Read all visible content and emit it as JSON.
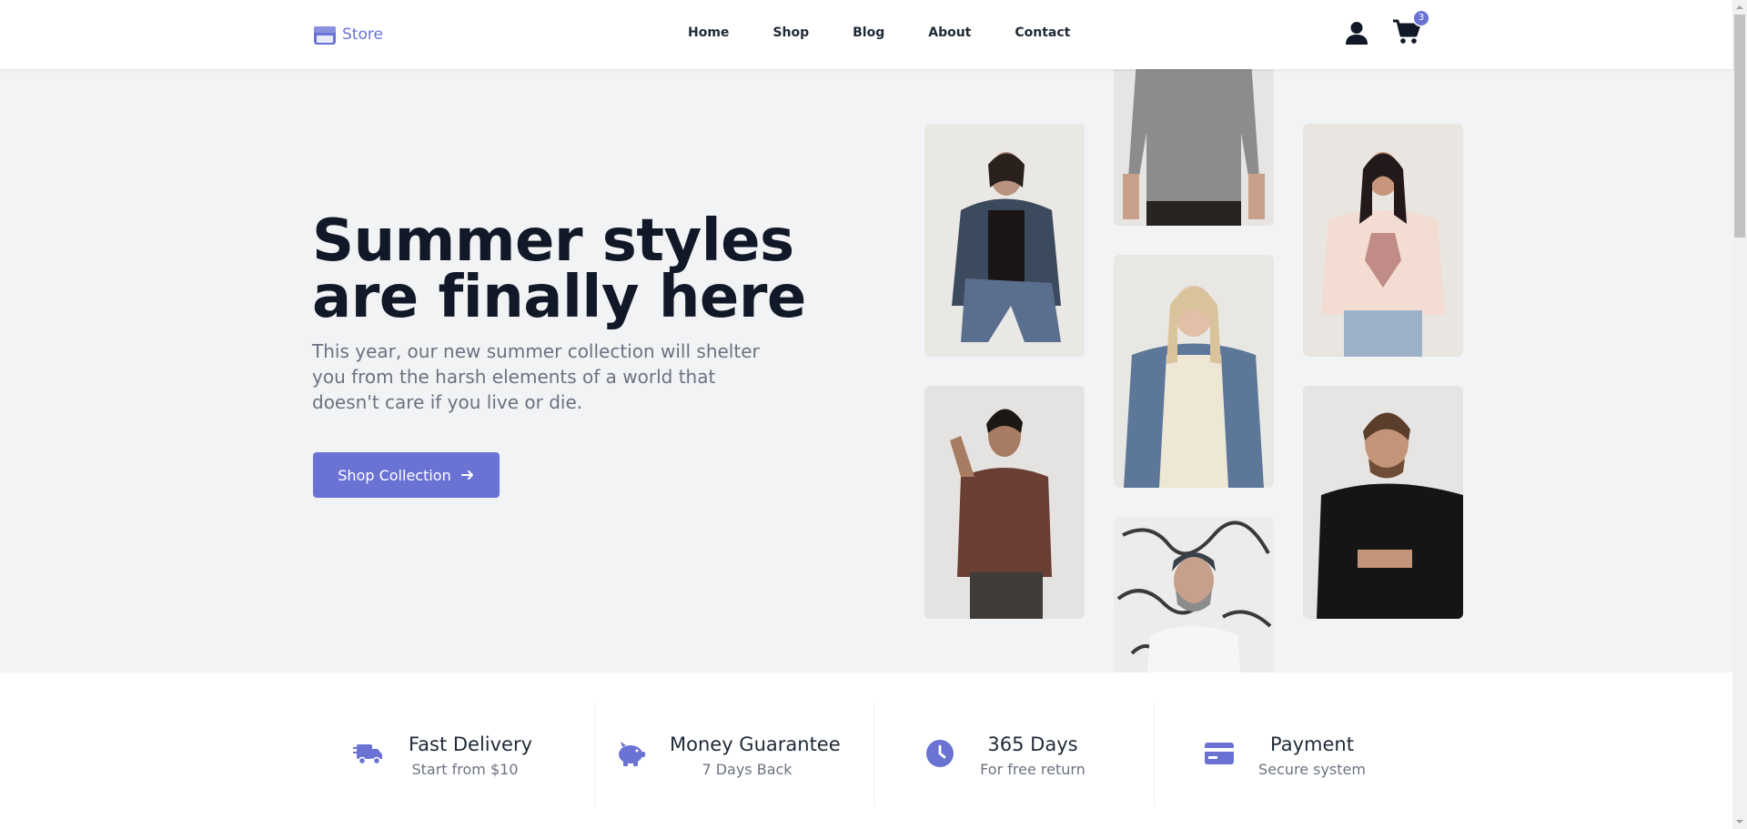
{
  "brand": {
    "name": "Store",
    "icon": "storefront-icon",
    "color": "#6a73d4"
  },
  "nav": {
    "links": [
      "Home",
      "Shop",
      "Blog",
      "About",
      "Contact"
    ],
    "user_icon": "user-icon",
    "cart_icon": "cart-icon",
    "cart_count": "3"
  },
  "hero": {
    "title": "Summer styles are finally here",
    "description": "This year, our new summer collection will shelter you from the harsh elements of a world that doesn't care if you live or die.",
    "cta_label": "Shop Collection",
    "cta_icon": "arrow-right-icon",
    "photos": [
      "woman-denim-jacket-photo",
      "man-grey-tshirt-photo",
      "woman-pink-tshirt-photo",
      "woman-denim-cream-top-photo",
      "man-brown-tshirt-photo",
      "man-black-tshirt-photo",
      "man-beanie-glasses-photo"
    ]
  },
  "features": [
    {
      "icon": "truck-icon",
      "title": "Fast Delivery",
      "subtitle": "Start from $10"
    },
    {
      "icon": "piggy-bank-icon",
      "title": "Money Guarantee",
      "subtitle": "7 Days Back"
    },
    {
      "icon": "clock-icon",
      "title": "365 Days",
      "subtitle": "For free return"
    },
    {
      "icon": "credit-card-icon",
      "title": "Payment",
      "subtitle": "Secure system"
    }
  ],
  "colors": {
    "accent": "#6a73d4",
    "hero_bg": "#f2f3f5",
    "text_dark": "#111827",
    "text_muted": "#6b7280"
  }
}
